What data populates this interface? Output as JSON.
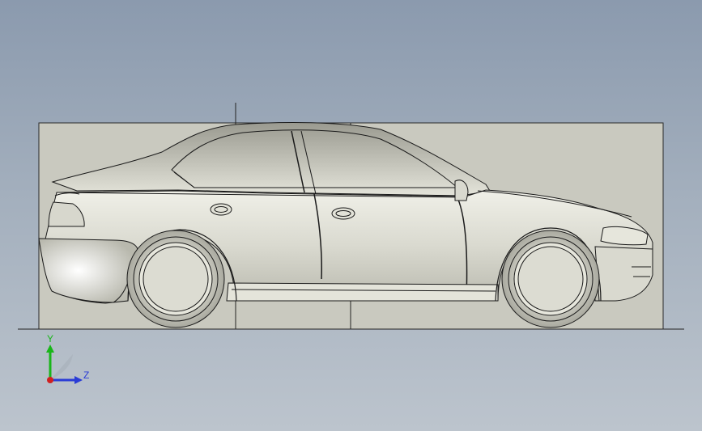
{
  "viewport": {
    "background_top": "#8b9aae",
    "background_bottom": "#bcc4cd",
    "sketch_plane_color": "#c9c9bf",
    "car_body_color": "#dcdcd2",
    "line_color": "#1a1a1a"
  },
  "triad": {
    "y_label": "Y",
    "z_label": "Z",
    "y_color": "#19b619",
    "z_color": "#2a3cd6",
    "origin_color": "#d02020"
  }
}
